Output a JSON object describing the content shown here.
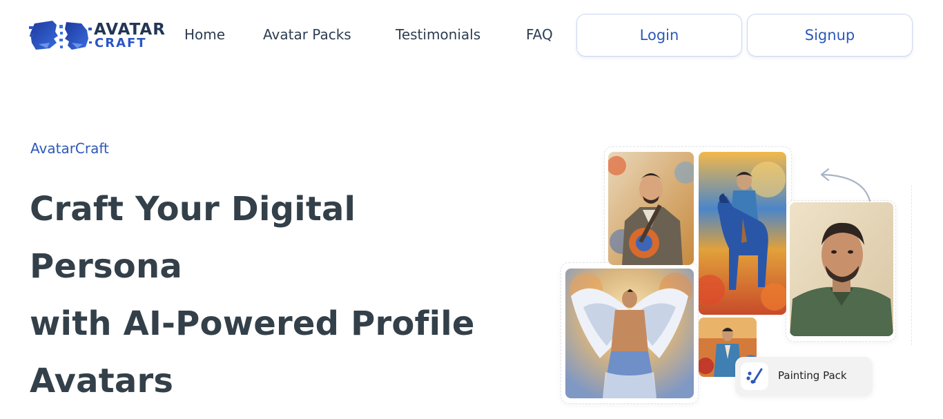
{
  "brand": {
    "logo_line1": "AVATAR",
    "logo_line2": "CRAFT",
    "eyebrow": "AvatarCraft"
  },
  "nav": {
    "items": [
      {
        "label": "Home"
      },
      {
        "label": "Avatar Packs"
      },
      {
        "label": "Testimonials"
      },
      {
        "label": "FAQ"
      }
    ],
    "login_label": "Login",
    "signup_label": "Signup"
  },
  "hero": {
    "headline_lines": [
      "Craft Your Digital",
      "Persona",
      "with AI-Powered Profile",
      "Avatars"
    ]
  },
  "collage": {
    "badge_label": "Painting Pack",
    "badge_icon": "paint-palette-icon",
    "arrow_icon": "curved-arrow-icon"
  },
  "colors": {
    "accent": "#2c58b8",
    "heading": "#334049",
    "nav_text": "#2d3d52",
    "logo_dark": "#233654"
  }
}
